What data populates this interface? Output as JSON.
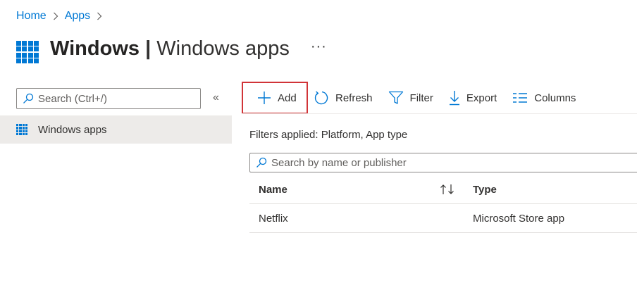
{
  "breadcrumb": {
    "home": "Home",
    "apps": "Apps"
  },
  "header": {
    "title_bold": "Windows",
    "title_sep": " | ",
    "title_sub": "Windows apps",
    "more": "···"
  },
  "left": {
    "search_placeholder": "Search (Ctrl+/)",
    "collapse": "«",
    "nav_item": "Windows apps"
  },
  "toolbar": {
    "add": "Add",
    "refresh": "Refresh",
    "filter": "Filter",
    "export": "Export",
    "columns": "Columns"
  },
  "filters_text": "Filters applied: Platform, App type",
  "grid_search_placeholder": "Search by name or publisher",
  "table": {
    "headers": {
      "name": "Name",
      "type": "Type"
    },
    "rows": [
      {
        "name": "Netflix",
        "type": "Microsoft Store app"
      }
    ]
  },
  "colors": {
    "accent": "#0078d4",
    "highlight": "#d13438",
    "nav_selected": "#edebe9"
  }
}
